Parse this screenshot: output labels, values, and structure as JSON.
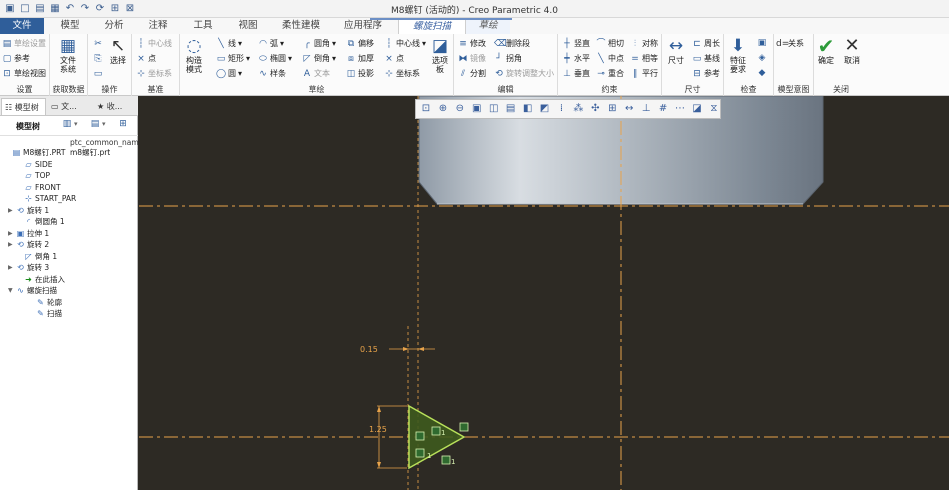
{
  "window": {
    "title": "M8螺钉 (活动的) - Creo Parametric 4.0",
    "quick_access_icons": [
      "new-icon",
      "open-icon",
      "save-icon",
      "undo-icon",
      "redo-icon",
      "regenerate-icon",
      "windows-icon",
      "close-window-icon"
    ]
  },
  "tabs": [
    "文件",
    "模型",
    "分析",
    "注释",
    "工具",
    "视图",
    "柔性建模",
    "应用程序",
    "螺旋扫描",
    "草绘"
  ],
  "ribbon": {
    "setup": {
      "label": "设置",
      "items": [
        "草绘设置",
        "参考",
        "草绘视图"
      ]
    },
    "get_data": {
      "label": "获取数据",
      "file_system": "文件\n系统"
    },
    "operations": {
      "label": "操作",
      "select": "选择"
    },
    "datum": {
      "label": "基准",
      "items": [
        "中心线",
        "点",
        "坐标系"
      ]
    },
    "sketch": {
      "label": "草绘",
      "construction_mode": "构造\n模式",
      "col1": [
        "线",
        "矩形",
        "圆"
      ],
      "col2": [
        "弧",
        "椭圆",
        "样条"
      ],
      "col3": [
        "圆角",
        "倒角",
        "文本"
      ],
      "col4": [
        "偏移",
        "加厚",
        "投影"
      ],
      "col5": [
        "中心线",
        "点",
        "坐标系"
      ],
      "palette": "选项\n板"
    },
    "editing": {
      "label": "编辑",
      "col1": [
        "修改",
        "镜像",
        "分割"
      ],
      "col2": [
        "删除段",
        "拐角",
        "旋转调整大小"
      ]
    },
    "constrain": {
      "label": "约束",
      "col1": [
        "竖直",
        "水平",
        "垂直"
      ],
      "col2": [
        "相切",
        "中点",
        "重合"
      ],
      "col3": [
        "对称",
        "相等",
        "平行"
      ]
    },
    "dimension": {
      "label": "尺寸",
      "big": "尺寸",
      "items": [
        "周长",
        "基线",
        "参考"
      ]
    },
    "inspect": {
      "label": "检查",
      "feature_requirements": "特征\n要求"
    },
    "model_intent": {
      "label": "模型意图",
      "relations": "关系"
    },
    "close": {
      "label": "关闭",
      "ok": "确定",
      "cancel": "取消"
    }
  },
  "model_tree": {
    "tabs": [
      "模型树",
      "文...",
      "收..."
    ],
    "toolbar_label": "模型树",
    "column_header": "ptc_common_name",
    "items": [
      {
        "label": "M8螺钉.PRT",
        "value": "m8螺钉.prt",
        "icon": "part-icon",
        "expander": ""
      },
      {
        "label": "SIDE",
        "icon": "datum-plane-icon",
        "expander": ""
      },
      {
        "label": "TOP",
        "icon": "datum-plane-icon",
        "expander": ""
      },
      {
        "label": "FRONT",
        "icon": "datum-plane-icon",
        "expander": ""
      },
      {
        "label": "START_PAR",
        "icon": "csys-icon",
        "expander": ""
      },
      {
        "label": "旋转 1",
        "icon": "revolve-icon",
        "expander": "▶"
      },
      {
        "label": "倒圆角 1",
        "icon": "round-icon",
        "expander": ""
      },
      {
        "label": "拉伸 1",
        "icon": "extrude-icon",
        "expander": "▶"
      },
      {
        "label": "旋转 2",
        "icon": "revolve-icon",
        "expander": "▶"
      },
      {
        "label": "倒角 1",
        "icon": "chamfer-icon",
        "expander": ""
      },
      {
        "label": "旋转 3",
        "icon": "revolve-icon",
        "expander": "▶"
      },
      {
        "label": "在此插入",
        "icon": "insert-here-icon",
        "expander": ""
      },
      {
        "label": "螺旋扫描",
        "icon": "helical-sweep-icon",
        "expander": "▼"
      },
      {
        "label": "轮廓",
        "icon": "sketch-icon",
        "expander": ""
      },
      {
        "label": "扫描",
        "icon": "sketch-icon",
        "expander": ""
      }
    ]
  },
  "graphics": {
    "toolbar_icons": [
      "refit-icon",
      "zoom-in-icon",
      "zoom-out-icon",
      "repaint-icon",
      "saved-views-icon",
      "view-manager-icon",
      "display-style-icon",
      "perspective-icon",
      "datum-display-icon",
      "annotation-display-icon",
      "spin-center-icon",
      "sketch-view-icon",
      "dimension-display-icon",
      "constraint-display-icon",
      "grid-display-icon",
      "vertex-display-icon",
      "section-icon",
      "filter-icon"
    ],
    "dimensions": {
      "horizontal": "0.15",
      "vertical": "1.25"
    },
    "constraint_labels": [
      "1",
      "1",
      "1"
    ],
    "colors": {
      "background": "#2d2a24",
      "centerline": "#e8a34a",
      "section_fill": "#3e5a1e",
      "section_edge": "#b8e05a"
    }
  }
}
